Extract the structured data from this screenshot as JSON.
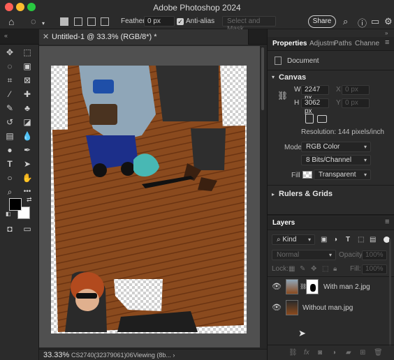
{
  "window": {
    "title": "Adobe Photoshop 2024",
    "traffic_colors": {
      "close": "#ff5f57",
      "minimize": "#febc2e",
      "maximize": "#28c840"
    }
  },
  "options_bar": {
    "feather_label": "Feather:",
    "feather_value": "0 px",
    "anti_alias_label": "Anti-alias",
    "select_mask_label": "Select and Mask...",
    "share_label": "Share"
  },
  "document": {
    "tab_label": "Untitled-1 @ 33.3% (RGB/8*) *",
    "zoom": "33.33%",
    "status_info": "CS2740(32379061)06Viewing (8b... ›"
  },
  "properties": {
    "tabs": [
      "Properties",
      "Adjustm",
      "Paths",
      "Channe"
    ],
    "doc_label": "Document",
    "canvas_title": "Canvas",
    "width_label": "W",
    "width_value": "2247 px",
    "height_label": "H",
    "height_value": "3062 px",
    "x_label": "X",
    "x_value": "0 px",
    "y_label": "Y",
    "y_value": "0 px",
    "resolution": "Resolution: 144 pixels/inch",
    "mode_label": "Mode",
    "mode_value": "RGB Color",
    "bits_value": "8 Bits/Channel",
    "fill_label": "Fill",
    "fill_value": "Transparent",
    "rulers_title": "Rulers & Grids"
  },
  "layers": {
    "title": "Layers",
    "filter_kind": "Kind",
    "blend_mode": "Normal",
    "opacity_label": "Opacity:",
    "opacity_value": "100%",
    "lock_label": "Lock:",
    "fill_label": "Fill:",
    "fill_value": "100%",
    "items": [
      {
        "name": "With man 2.jpg"
      },
      {
        "name": "Without man.jpg"
      }
    ]
  },
  "colors": {
    "foreground": "#000000",
    "background": "#ffffff",
    "deck": "#8a4a1e",
    "panel_bg": "#2b2b2b"
  },
  "icons": [
    "home-icon",
    "lasso-icon",
    "gear-icon",
    "help-icon",
    "search-icon",
    "panel-menu-icon",
    "eye-icon",
    "link-icon"
  ]
}
